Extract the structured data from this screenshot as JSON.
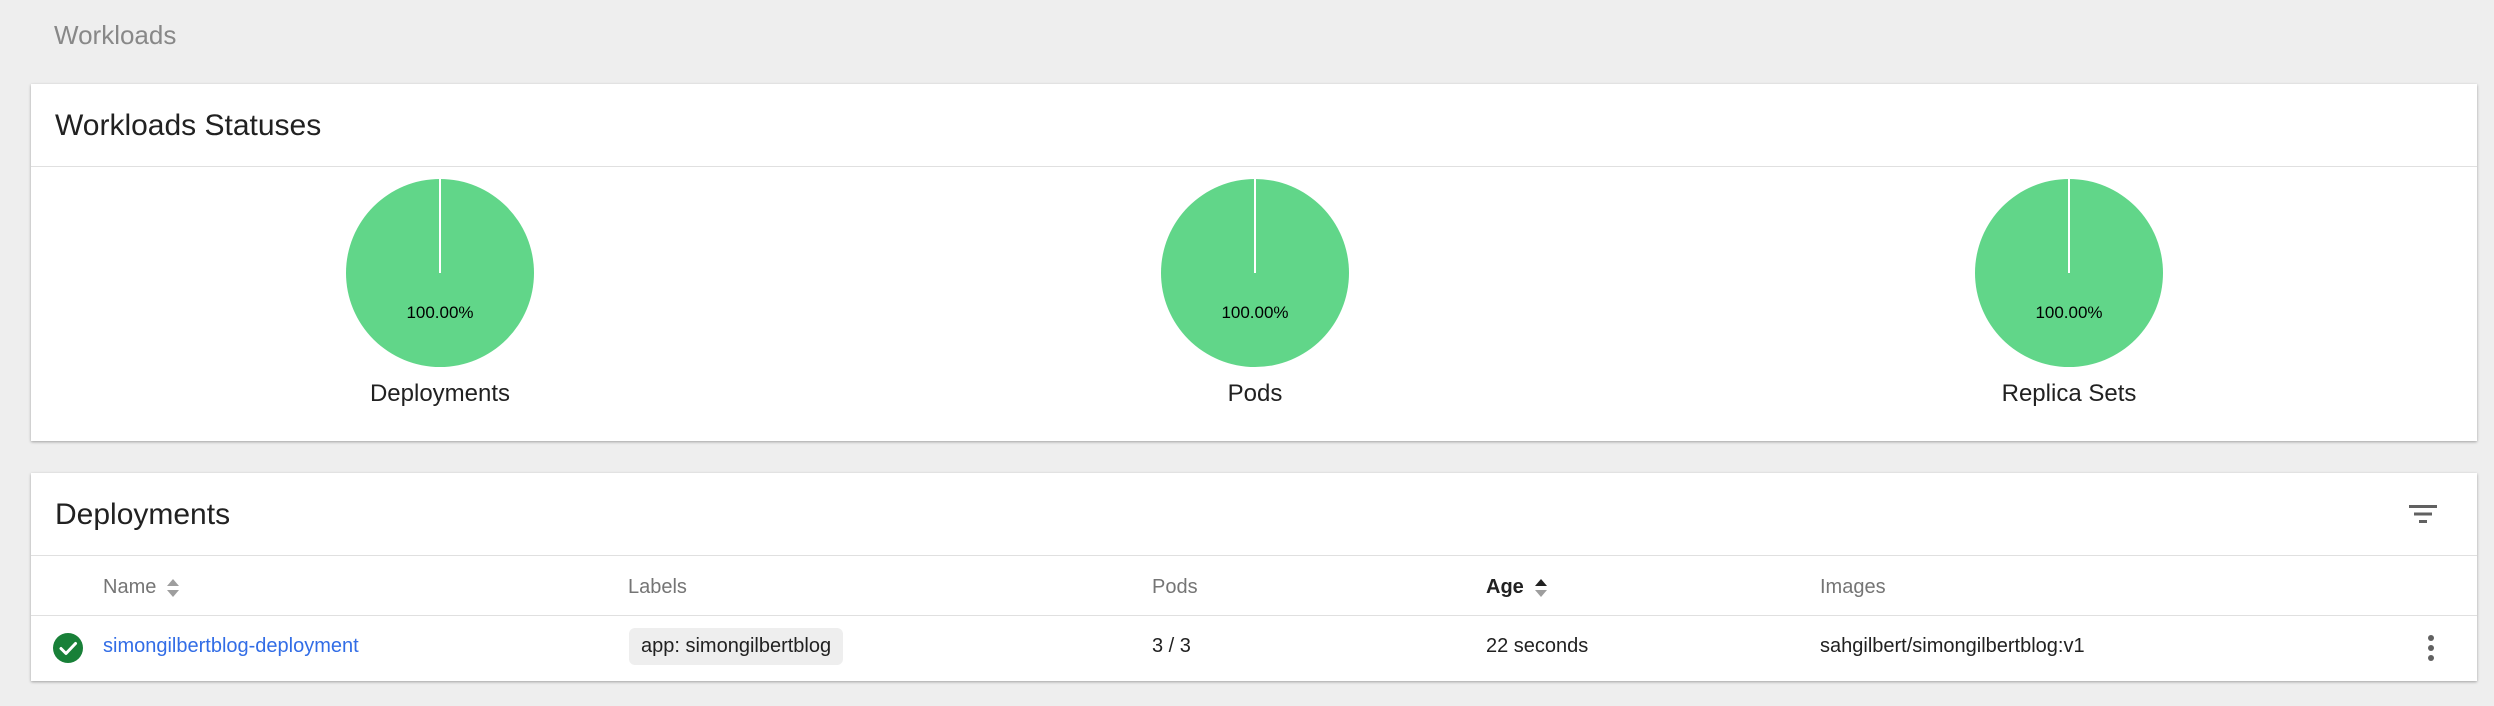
{
  "breadcrumb": "Workloads",
  "statuses": {
    "title": "Workloads Statuses",
    "charts": [
      {
        "label": "Deployments",
        "percent_text": "100.00%",
        "running_percent": 100
      },
      {
        "label": "Pods",
        "percent_text": "100.00%",
        "running_percent": 100
      },
      {
        "label": "Replica Sets",
        "percent_text": "100.00%",
        "running_percent": 100
      }
    ],
    "color_running": "#61d689"
  },
  "deployments": {
    "title": "Deployments",
    "filter_icon": "filter-list-icon",
    "columns": {
      "name": "Name",
      "labels": "Labels",
      "pods": "Pods",
      "age": "Age",
      "images": "Images"
    },
    "rows": [
      {
        "status_icon": "check-circle-icon",
        "status_color": "#188038",
        "name": "simongilbertblog-deployment",
        "label": "app: simongilbertblog",
        "pods": "3 / 3",
        "age": "22 seconds",
        "image": "sahgilbert/simongilbertblog:v1"
      }
    ],
    "link_color": "#326de6"
  }
}
